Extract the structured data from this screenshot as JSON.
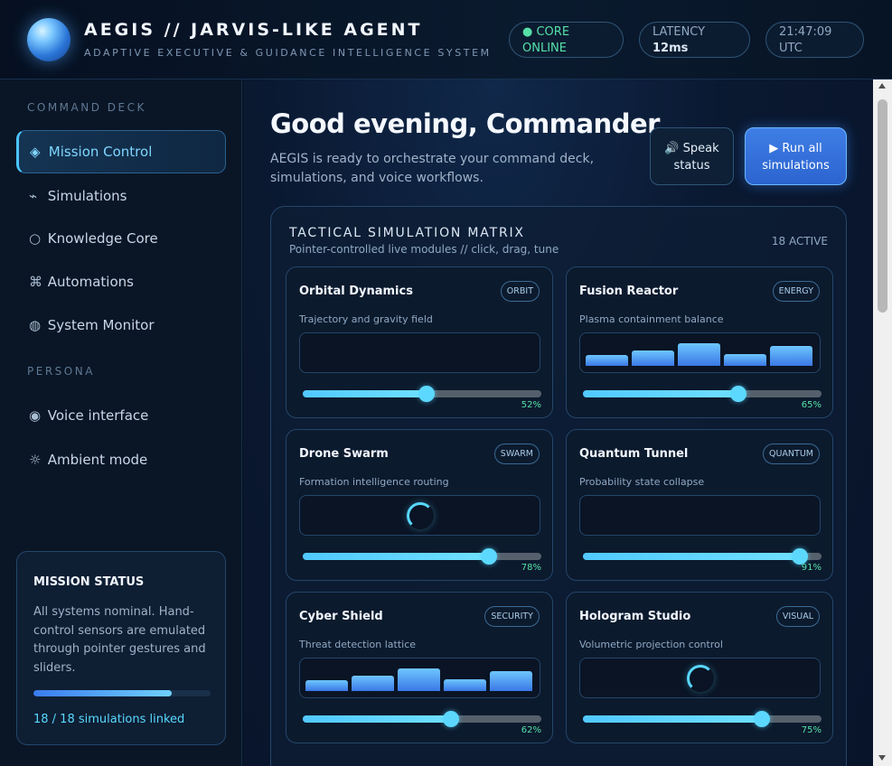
{
  "header": {
    "title": "AEGIS // JARVIS-LIKE AGENT",
    "subtitle": "ADAPTIVE EXECUTIVE & GUIDANCE INTELLIGENCE SYSTEM",
    "status": {
      "line1": "● CORE",
      "line2": "ONLINE"
    },
    "latency": {
      "label": "LATENCY",
      "value": "12ms"
    },
    "clock": {
      "time": "21:47:09",
      "zone": "UTC"
    }
  },
  "sidebar": {
    "command_label": "COMMAND DECK",
    "command_items": [
      {
        "glyph": "◈",
        "label": "Mission Control"
      },
      {
        "glyph": "⌁",
        "label": "Simulations"
      },
      {
        "glyph": "○",
        "label": "Knowledge Core"
      },
      {
        "glyph": "⌘",
        "label": "Automations"
      },
      {
        "glyph": "◍",
        "label": "System Monitor"
      }
    ],
    "persona_label": "PERSONA",
    "persona_items": [
      {
        "glyph": "◉",
        "label": "Voice interface"
      },
      {
        "glyph": "☼",
        "label": "Ambient mode"
      }
    ],
    "mission": {
      "title": "MISSION STATUS",
      "text": "All systems nominal. Hand-control sensors are emulated through pointer gestures and sliders.",
      "progress": 0.78,
      "linked": "18 / 18 simulations linked"
    }
  },
  "main": {
    "greeting": "Good evening, Commander.",
    "greeting_sub": "AEGIS is ready to orchestrate your command deck, simulations, and voice workflows.",
    "speak_button": {
      "line1": "🔊 Speak",
      "line2": "status"
    },
    "run_button": {
      "line1": "▶ Run all",
      "line2": "simulations"
    },
    "matrix": {
      "title": "TACTICAL SIMULATION MATRIX",
      "subtitle": "Pointer-controlled live modules // click, drag, tune",
      "count": "18 ACTIVE",
      "modules": [
        {
          "title": "Orbital Dynamics",
          "tag": "ORBIT",
          "desc": "Trajectory and gravity field",
          "value": 52,
          "pct": "52%",
          "visual": "empty"
        },
        {
          "title": "Fusion Reactor",
          "tag": "ENERGY",
          "desc": "Plasma containment balance",
          "value": 65,
          "pct": "65%",
          "visual": "bars"
        },
        {
          "title": "Drone Swarm",
          "tag": "SWARM",
          "desc": "Formation intelligence routing",
          "value": 78,
          "pct": "78%",
          "visual": "spinner"
        },
        {
          "title": "Quantum Tunnel",
          "tag": "QUANTUM",
          "desc": "Probability state collapse",
          "value": 91,
          "pct": "91%",
          "visual": "empty"
        },
        {
          "title": "Cyber Shield",
          "tag": "SECURITY",
          "desc": "Threat detection lattice",
          "value": 62,
          "pct": "62%",
          "visual": "bars"
        },
        {
          "title": "Hologram Studio",
          "tag": "VISUAL",
          "desc": "Volumetric projection control",
          "value": 75,
          "pct": "75%",
          "visual": "spinner"
        }
      ]
    }
  },
  "colors": {
    "accent": "#4cc4ff",
    "online": "#56e0a8",
    "primary_button": "#3a78e6"
  }
}
